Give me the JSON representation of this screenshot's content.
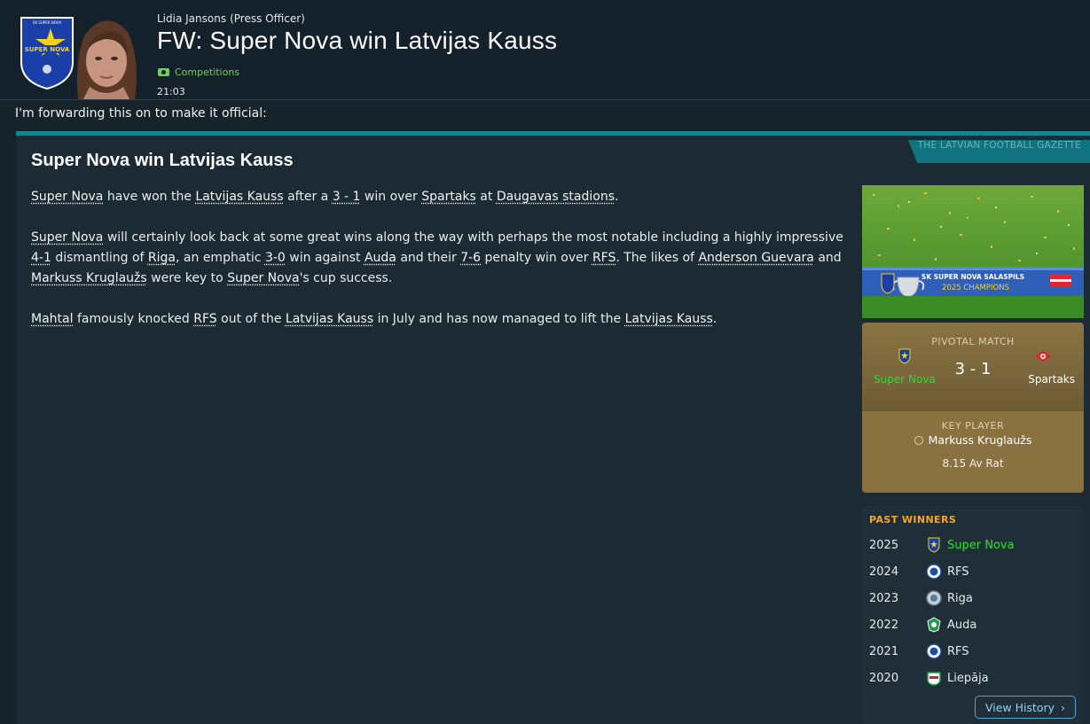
{
  "header": {
    "sender_name": "Lidia Jansons",
    "sender_role": "(Press Officer)",
    "subject": "FW: Super Nova win Latvijas Kauss",
    "tag": "Competitions",
    "time": "21:03",
    "badge_text": "SK SUPER NOVA"
  },
  "intro": "I'm forwarding this on to make it official:",
  "article": {
    "paper": "THE LATVIAN FOOTBALL GAZETTE",
    "headline": "Super Nova win Latvijas Kauss",
    "p1": {
      "t1": "Super Nova",
      "t2": " have won the ",
      "t3": "Latvijas Kauss",
      "t4": " after a ",
      "t5": "3 - 1",
      "t6": " win over ",
      "t7": "Spartaks",
      "t8": " at ",
      "t9": "Daugavas stadions",
      "t10": "."
    },
    "p2": {
      "t1": "Super Nova",
      "t2": " will certainly look back at some great wins along the way with perhaps the most notable including a highly impressive ",
      "t3": "4-1",
      "t4": " dismantling of ",
      "t5": "Riga",
      "t6": ", an emphatic ",
      "t7": "3-0",
      "t8": " win against ",
      "t9": "Auda",
      "t10": " and their ",
      "t11": "7-6",
      "t12": " penalty win over ",
      "t13": "RFS",
      "t14": ". The likes of ",
      "t15": "Anderson Guevara",
      "t16": " and ",
      "t17": "Markuss Kruglaužs",
      "t18": " were key to ",
      "t19": "Super Nova",
      "t20": "'s cup success."
    },
    "p3": {
      "t1": "Mahtal",
      "t2": " famously knocked ",
      "t3": "RFS",
      "t4": " out of the ",
      "t5": "Latvijas Kauss",
      "t6": " in July and has now managed to lift the ",
      "t7": "Latvijas Kauss",
      "t8": "."
    }
  },
  "trophy_banner": {
    "club": "SK SUPER NOVA SALASPILS",
    "caption": "2025 CHAMPIONS"
  },
  "pivotal": {
    "title": "PIVOTAL MATCH",
    "home": "Super Nova",
    "score": "3 - 1",
    "away": "Spartaks"
  },
  "key_player": {
    "title": "KEY PLAYER",
    "name": "Markuss Kruglaužs",
    "rating": "8.15 Av Rat"
  },
  "past_winners": {
    "title": "PAST WINNERS",
    "rows": [
      {
        "year": "2025",
        "team": "Super Nova",
        "badge": "supernova-badge-icon"
      },
      {
        "year": "2024",
        "team": "RFS",
        "badge": "rfs-badge-icon"
      },
      {
        "year": "2023",
        "team": "Riga",
        "badge": "riga-badge-icon"
      },
      {
        "year": "2022",
        "team": "Auda",
        "badge": "auda-badge-icon"
      },
      {
        "year": "2021",
        "team": "RFS",
        "badge": "rfs-badge-icon"
      },
      {
        "year": "2020",
        "team": "Liepāja",
        "badge": "liepaja-badge-icon"
      }
    ],
    "button": "View History"
  },
  "colors": {
    "accent": "#128591",
    "gold_panel": "#8a7240",
    "highlight_green": "#28e028",
    "past_title": "#f5a623"
  }
}
